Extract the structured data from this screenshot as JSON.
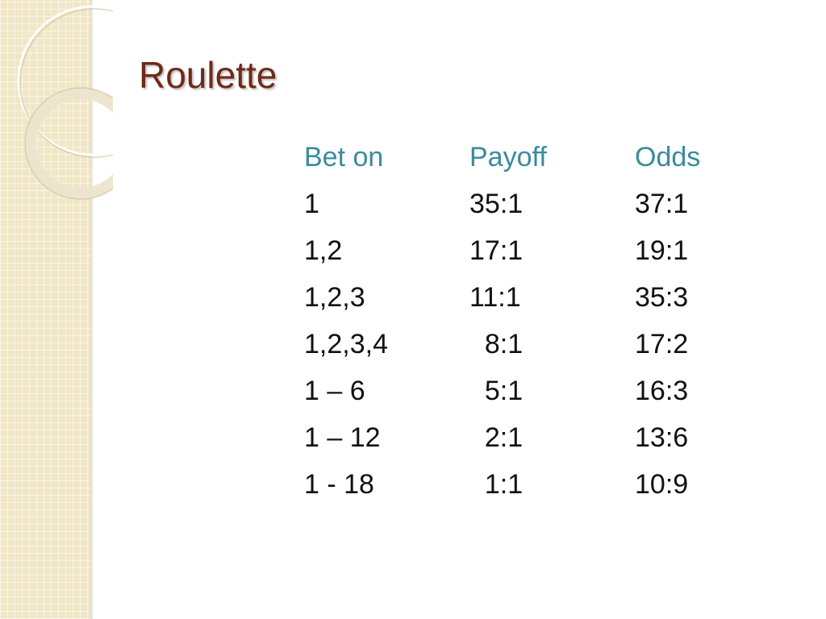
{
  "slide": {
    "title": "Roulette"
  },
  "table": {
    "headers": [
      "Bet on",
      "Payoff",
      "Odds"
    ],
    "rows": [
      [
        "1",
        "35:1",
        "37:1"
      ],
      [
        "1,2",
        "17:1",
        "19:1"
      ],
      [
        "1,2,3",
        "11:1",
        "35:3"
      ],
      [
        "1,2,3,4",
        "  8:1",
        "17:2"
      ],
      [
        "1 – 6",
        "  5:1",
        "16:3"
      ],
      [
        "1 – 12",
        "  2:1",
        "13:6"
      ],
      [
        "1 - 18",
        "  1:1",
        "10:9"
      ]
    ]
  },
  "colors": {
    "title": "#6f2a17",
    "header": "#3b8b9b",
    "body_text": "#111111",
    "side_strip": "#f1e7c6"
  }
}
